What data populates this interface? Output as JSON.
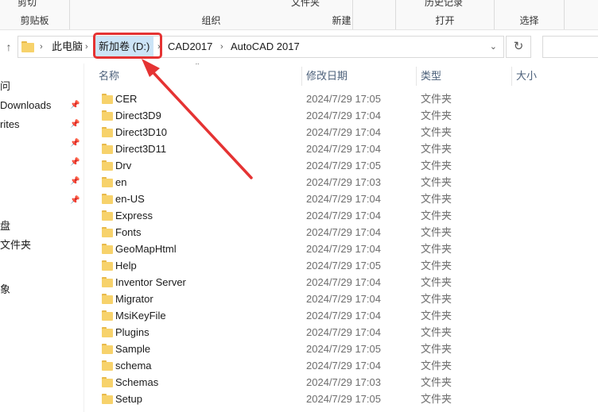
{
  "ribbon": {
    "groups": [
      {
        "title": "剪贴板",
        "top_item": "剪切"
      },
      {
        "title": "组织",
        "top_item": ""
      },
      {
        "title": "新建",
        "top_item": "文件夹"
      },
      {
        "title": "打开",
        "top_item": "历史记录"
      },
      {
        "title": "选择",
        "top_item": ""
      }
    ]
  },
  "address": {
    "crumbs": [
      "此电脑",
      "新加卷 (D:)",
      "CAD2017",
      "AutoCAD 2017"
    ]
  },
  "nav": {
    "items": [
      {
        "label": "问",
        "pinned": false
      },
      {
        "label": "Downloads",
        "pinned": true
      },
      {
        "label": "rites",
        "pinned": true
      },
      {
        "label": "",
        "pinned": true
      },
      {
        "label": "",
        "pinned": true
      },
      {
        "label": "",
        "pinned": true
      },
      {
        "label": "",
        "pinned": true
      },
      {
        "label": "盘",
        "pinned": false
      },
      {
        "label": "文件夹",
        "pinned": false
      },
      {
        "label": "象",
        "pinned": false
      }
    ]
  },
  "columns": {
    "name": "名称",
    "modified": "修改日期",
    "type": "类型",
    "size": "大小"
  },
  "files": [
    {
      "name": "CER",
      "modified": "2024/7/29 17:05",
      "type": "文件夹"
    },
    {
      "name": "Direct3D9",
      "modified": "2024/7/29 17:04",
      "type": "文件夹"
    },
    {
      "name": "Direct3D10",
      "modified": "2024/7/29 17:04",
      "type": "文件夹"
    },
    {
      "name": "Direct3D11",
      "modified": "2024/7/29 17:04",
      "type": "文件夹"
    },
    {
      "name": "Drv",
      "modified": "2024/7/29 17:05",
      "type": "文件夹"
    },
    {
      "name": "en",
      "modified": "2024/7/29 17:03",
      "type": "文件夹"
    },
    {
      "name": "en-US",
      "modified": "2024/7/29 17:04",
      "type": "文件夹"
    },
    {
      "name": "Express",
      "modified": "2024/7/29 17:04",
      "type": "文件夹"
    },
    {
      "name": "Fonts",
      "modified": "2024/7/29 17:04",
      "type": "文件夹"
    },
    {
      "name": "GeoMapHtml",
      "modified": "2024/7/29 17:04",
      "type": "文件夹"
    },
    {
      "name": "Help",
      "modified": "2024/7/29 17:05",
      "type": "文件夹"
    },
    {
      "name": "Inventor Server",
      "modified": "2024/7/29 17:04",
      "type": "文件夹"
    },
    {
      "name": "Migrator",
      "modified": "2024/7/29 17:04",
      "type": "文件夹"
    },
    {
      "name": "MsiKeyFile",
      "modified": "2024/7/29 17:04",
      "type": "文件夹"
    },
    {
      "name": "Plugins",
      "modified": "2024/7/29 17:04",
      "type": "文件夹"
    },
    {
      "name": "Sample",
      "modified": "2024/7/29 17:05",
      "type": "文件夹"
    },
    {
      "name": "schema",
      "modified": "2024/7/29 17:04",
      "type": "文件夹"
    },
    {
      "name": "Schemas",
      "modified": "2024/7/29 17:03",
      "type": "文件夹"
    },
    {
      "name": "Setup",
      "modified": "2024/7/29 17:05",
      "type": "文件夹"
    }
  ],
  "colors": {
    "highlight": "#cce4f7",
    "annotation": "#e53333",
    "folder": "#f7d26b"
  }
}
